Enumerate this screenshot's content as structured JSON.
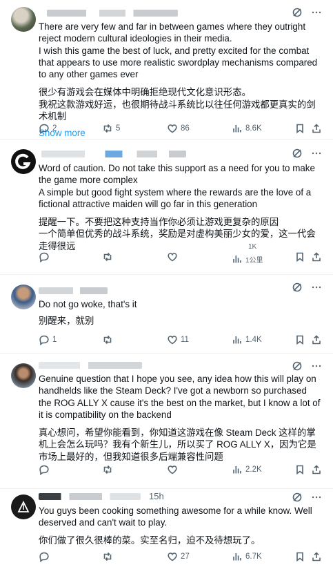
{
  "tweets": [
    {
      "time": "",
      "en": [
        "There are very few and far in between games where they outright reject modern cultural ideologies in their media.",
        "I wish this game the best of luck, and pretty excited for the combat that appears to use more realistic swordplay mechanisms compared to any other games ever"
      ],
      "zh": [
        "很少有游戏会在媒体中明确拒绝现代文化意识形态。",
        "我祝这款游戏好运，也很期待战斗系统比以往任何游戏都更真实的剑术机制"
      ],
      "show_more": "Show more",
      "replies": "2",
      "reposts": "5",
      "likes": "86",
      "views": "8.6K"
    },
    {
      "time": "",
      "en": [
        "Word of caution. Do not take this support as a need for you to make the game more complex",
        "A simple but good fight system where the rewards are the love of a fictional attractive maiden will go far in this generation"
      ],
      "zh": [
        "提醒一下。不要把这种支持当作你必须让游戏更复杂的原因",
        "一个简单但优秀的战斗系统，奖励是对虚构美丽少女的爱，这一代会走得很远"
      ],
      "replies": "",
      "reposts": "",
      "likes": "",
      "views": "1K",
      "views_sub": "1公里"
    },
    {
      "time": "",
      "en": [
        "Do not go woke, that's it"
      ],
      "zh": [
        "别醒来，就别"
      ],
      "replies": "1",
      "reposts": "",
      "likes": "11",
      "views": "1.4K"
    },
    {
      "time": "",
      "en": [
        "Genuine question that I hope you see, any idea how this will play on handhelds like the Steam Deck? I've got a newborn so purchased the ROG ALLY X cause it's the best on the market, but I know a lot of it is compatibility on the backend"
      ],
      "zh": [
        "真心想问，希望你能看到，你知道这游戏在像 Steam Deck 这样的掌机上会怎么玩吗？我有个新生儿，所以买了 ROG ALLY X，因为它是市场上最好的，但我知道很多后端兼容性问题"
      ],
      "replies": "",
      "reposts": "",
      "likes": "",
      "views": "2.2K"
    },
    {
      "time": "15h",
      "en": [
        "You guys been cooking something awesome for a while know. Well deserved and can't wait to play."
      ],
      "zh": [
        "你们做了很久很棒的菜。实至名归，迫不及待想玩了。"
      ],
      "replies": "",
      "reposts": "",
      "likes": "27",
      "views": "6.7K"
    }
  ],
  "icons": [
    "grok-icon",
    "more-icon",
    "reply-icon",
    "repost-icon",
    "like-icon",
    "views-icon",
    "bookmark-icon",
    "share-icon"
  ]
}
